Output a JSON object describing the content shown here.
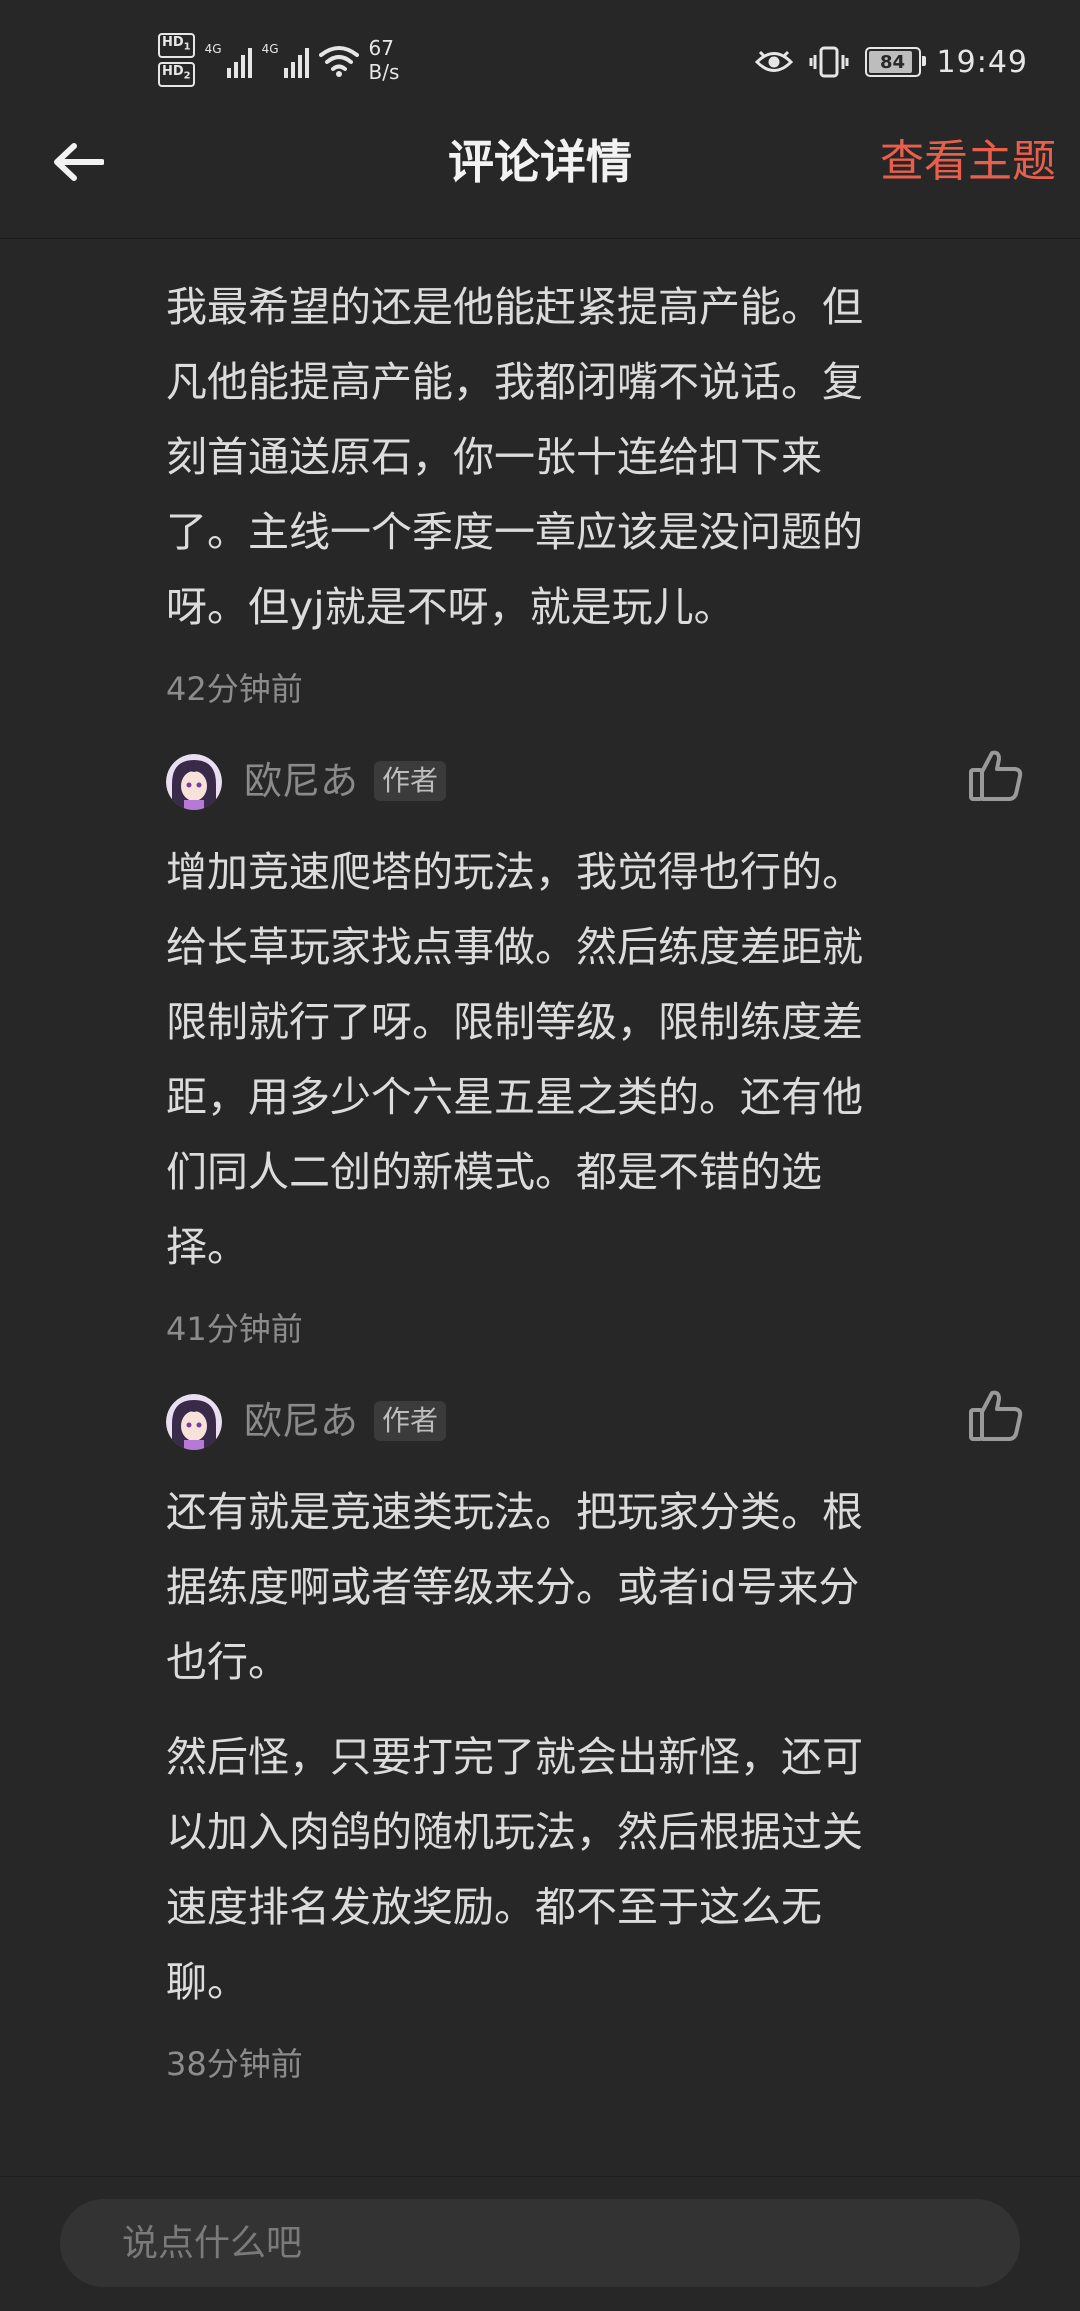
{
  "status_bar": {
    "hd1": "HD",
    "hd1_sub": "1",
    "hd2": "HD",
    "hd2_sub": "2",
    "net1": "4G",
    "net2": "4G",
    "speed_value": "67",
    "speed_unit": "B/s",
    "battery": "84",
    "time": "19:49"
  },
  "header": {
    "title": "评论详情",
    "view_topic": "查看主题"
  },
  "comments": [
    {
      "paragraphs": [
        "我最希望的还是他能赶紧提高产能。但凡他能提高产能，我都闭嘴不说话。复刻首通送原石，你一张十连给扣下来了。主线一个季度一章应该是没问题的呀。但yj就是不呀，就是玩儿。"
      ],
      "time": "42分钟前"
    },
    {
      "author": "欧尼あ",
      "badge": "作者",
      "paragraphs": [
        "增加竞速爬塔的玩法，我觉得也行的。给长草玩家找点事做。然后练度差距就限制就行了呀。限制等级，限制练度差距，用多少个六星五星之类的。还有他们同人二创的新模式。都是不错的选择。"
      ],
      "time": "41分钟前"
    },
    {
      "author": "欧尼あ",
      "badge": "作者",
      "paragraphs": [
        "还有就是竞速类玩法。把玩家分类。根据练度啊或者等级来分。或者id号来分也行。",
        "然后怪，只要打完了就会出新怪，还可以加入肉鸽的随机玩法，然后根据过关速度排名发放奖励。都不至于这么无聊。"
      ],
      "time": "38分钟前"
    }
  ],
  "input": {
    "placeholder": "说点什么吧"
  },
  "colors": {
    "background": "#272727",
    "accent": "#e8604d",
    "text": "#dcdcdc",
    "muted": "#8c8c8c"
  },
  "icons": {
    "back": "arrow-left-icon",
    "like": "thumbs-up-icon",
    "eye": "eye-icon",
    "vibrate": "vibrate-icon",
    "wifi": "wifi-icon"
  }
}
